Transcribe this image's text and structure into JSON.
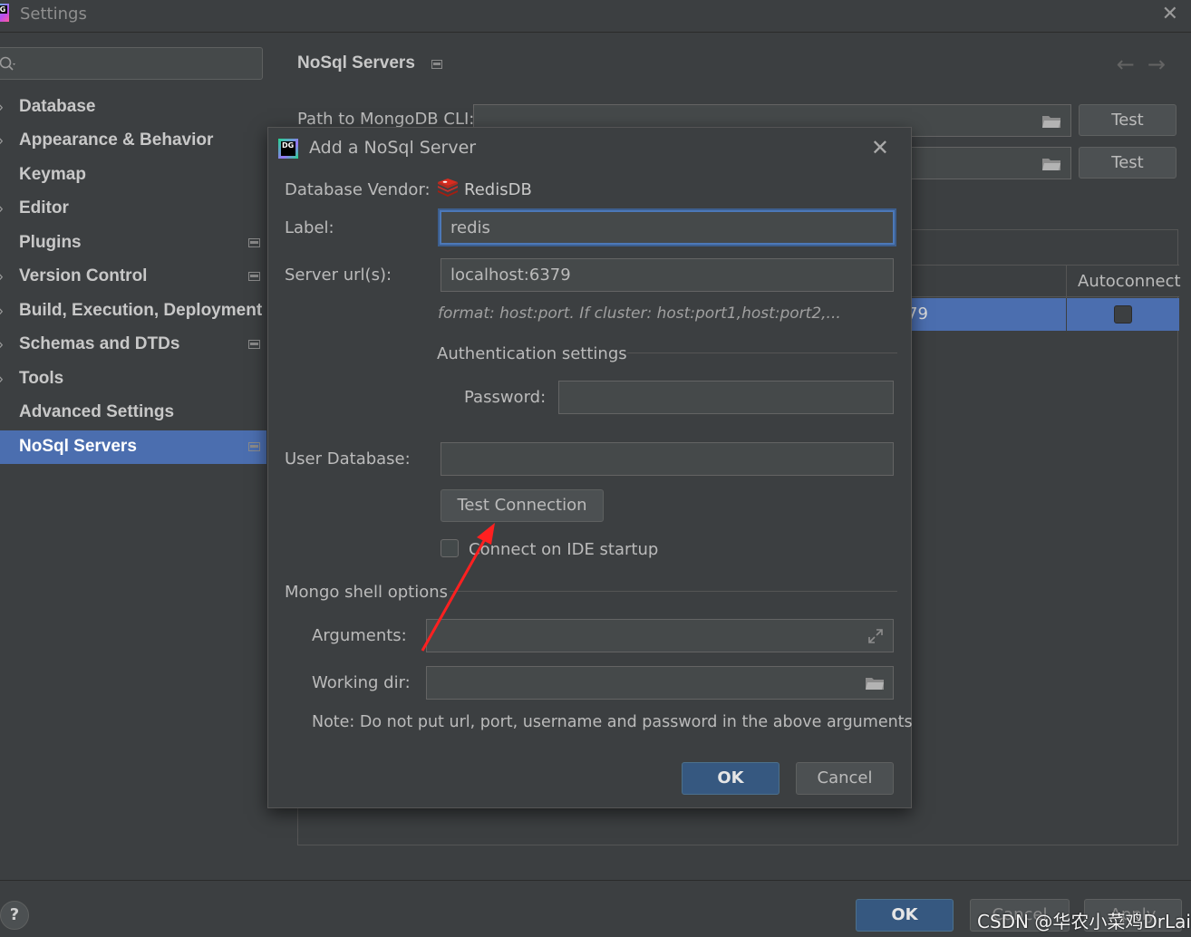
{
  "window": {
    "title": "Settings"
  },
  "sidebar": {
    "search_placeholder": "",
    "items": [
      {
        "label": "Database",
        "expandable": true,
        "project": false
      },
      {
        "label": "Appearance & Behavior",
        "expandable": true,
        "project": false
      },
      {
        "label": "Keymap",
        "expandable": false,
        "project": false
      },
      {
        "label": "Editor",
        "expandable": true,
        "project": false
      },
      {
        "label": "Plugins",
        "expandable": false,
        "project": true
      },
      {
        "label": "Version Control",
        "expandable": true,
        "project": true
      },
      {
        "label": "Build, Execution, Deployment",
        "expandable": true,
        "project": false
      },
      {
        "label": "Schemas and DTDs",
        "expandable": true,
        "project": true
      },
      {
        "label": "Tools",
        "expandable": true,
        "project": false
      },
      {
        "label": "Advanced Settings",
        "expandable": false,
        "project": false
      },
      {
        "label": "NoSql Servers",
        "expandable": false,
        "project": true,
        "selected": true
      }
    ]
  },
  "panel": {
    "title": "NoSql Servers",
    "cli_label": "Path to MongoDB CLI:",
    "test_button_1": "Test",
    "test_button_2": "Test",
    "table": {
      "autoconnect_header": "Autoconnect",
      "row_url_fragment": "79"
    }
  },
  "dialog": {
    "title": "Add a NoSql Server",
    "vendor_label": "Database Vendor:",
    "vendor_value": "RedisDB",
    "label_label": "Label:",
    "label_value": "redis",
    "server_url_label": "Server url(s):",
    "server_url_value": "localhost:6379",
    "format_hint": "format: host:port. If cluster: host:port1,host:port2,...",
    "auth_section": "Authentication settings",
    "password_label": "Password:",
    "password_value": "",
    "user_db_label": "User Database:",
    "user_db_value": "",
    "test_connection_button": "Test Connection",
    "connect_startup_label": "Connect on IDE startup",
    "connect_startup_checked": false,
    "mongo_section": "Mongo shell options",
    "arguments_label": "Arguments:",
    "arguments_value": "",
    "working_dir_label": "Working dir:",
    "working_dir_value": "",
    "note": "Note: Do not put url, port, username and password in the above arguments",
    "ok_button": "OK",
    "cancel_button": "Cancel"
  },
  "bottom": {
    "help": "?",
    "ok_button": "OK",
    "cancel_button": "Cancel",
    "apply_button": "Apply",
    "watermark": "CSDN @华农小菜鸡DrLai"
  },
  "colors": {
    "background": "#3c3f41",
    "selection": "#4b6eaf",
    "primary_button": "#365880",
    "annotation_arrow": "#ff2020"
  }
}
